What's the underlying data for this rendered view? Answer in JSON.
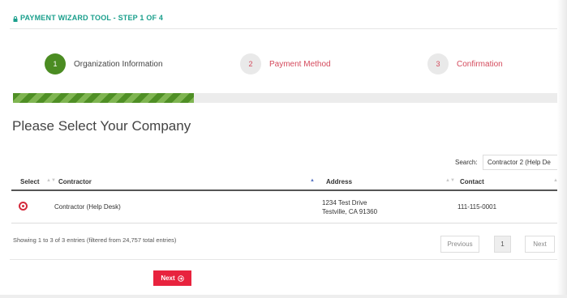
{
  "header": {
    "title": "PAYMENT WIZARD TOOL - STEP 1 OF 4"
  },
  "steps": [
    {
      "number": "1",
      "label": "Organization Information",
      "state": "active"
    },
    {
      "number": "2",
      "label": "Payment Method",
      "state": "inactive"
    },
    {
      "number": "3",
      "label": "Confirmation",
      "state": "inactive"
    }
  ],
  "progress": {
    "fraction": 0.33
  },
  "main": {
    "heading": "Please Select Your Company",
    "search": {
      "label": "Search:",
      "value": "Contractor 2 (Help De"
    }
  },
  "table": {
    "columns": [
      "Select",
      "Contractor",
      "Address",
      "Contact"
    ],
    "rows": [
      {
        "contractor": "Contractor (Help Desk)",
        "address_line1": "1234 Test Drive",
        "address_line2": "Testville, CA 91360",
        "contact": "111-115-0001"
      }
    ],
    "info": "Showing 1 to 3 of 3 entries (filtered from 24,757 total entries)"
  },
  "pagination": {
    "previous": "Previous",
    "current": "1",
    "next": "Next"
  },
  "footer": {
    "next_label": "Next"
  },
  "colors": {
    "title_teal": "#1a9f8c",
    "step_active_green": "#4b8c22",
    "step_inactive_red": "#d44a5c",
    "primary_red": "#e8233e"
  }
}
